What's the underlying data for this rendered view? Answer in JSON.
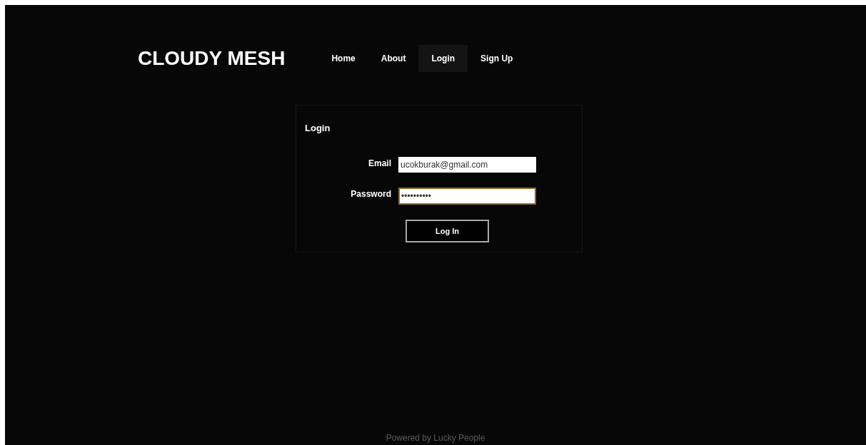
{
  "logo": "CLOUDY MESH",
  "nav": [
    {
      "label": "Home",
      "selected": false
    },
    {
      "label": "About",
      "selected": false
    },
    {
      "label": "Login",
      "selected": true
    },
    {
      "label": "Sign Up",
      "selected": false
    }
  ],
  "login_panel": {
    "title": "Login",
    "fields": [
      {
        "label": "Email",
        "value": "ucokburak@gmail.com",
        "focused": false
      },
      {
        "label": "Password",
        "value": "••••••••••",
        "focused": true
      }
    ],
    "button": "Log In"
  },
  "footer": "Powered by Lucky People"
}
